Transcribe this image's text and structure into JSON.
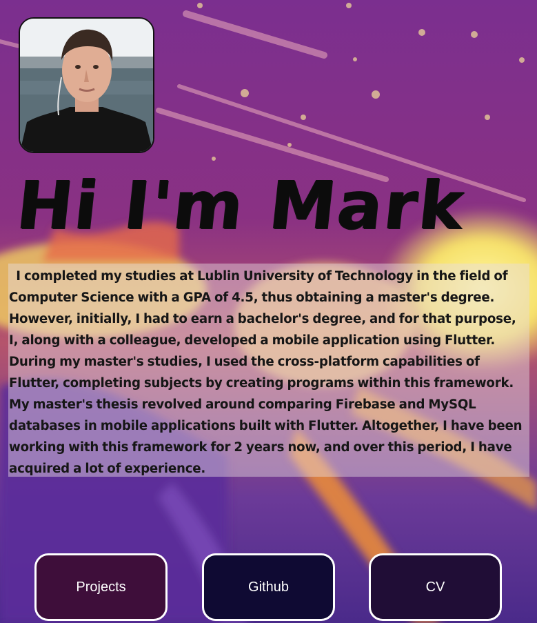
{
  "hero": {
    "title": "Hi I'm Mark"
  },
  "profile": {
    "photo": "profile-photo"
  },
  "bio": {
    "text": "  I completed my studies at Lublin University of Technology in the field of Computer Science with a GPA of 4.5, thus obtaining a master's degree. However, initially, I had to earn a bachelor's degree, and for that purpose, I, along with a colleague, developed a mobile application using Flutter. During my master's studies, I used the cross-platform capabilities of Flutter, completing subjects by creating programs within this framework. My master's thesis revolved around comparing Firebase and MySQL databases in mobile applications built with Flutter. Altogether, I have been working with this framework for 2 years now, and over this period, I have acquired a lot of experience."
  },
  "buttons": {
    "projects": "Projects",
    "github": "Github",
    "cv": "CV"
  },
  "colors": {
    "background": "#6a2a86",
    "projects_button": "#3e0e3a",
    "github_button": "#0f0a33",
    "cv_button": "#200d36",
    "border": "#ffffff"
  }
}
